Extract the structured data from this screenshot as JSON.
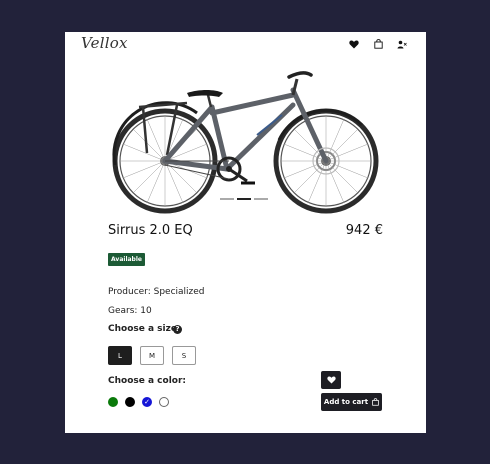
{
  "brand": {
    "logo_text": "Vellox"
  },
  "header": {
    "icons": [
      "heart-icon",
      "shopping-bag-icon",
      "user-icon"
    ]
  },
  "product": {
    "name": "Sirrus 2.0 EQ",
    "price": "942 €",
    "availability": "Available",
    "producer": "Producer: Specialized",
    "gears": "Gears: 10",
    "image_carousel": {
      "slides": 3,
      "active": 2
    }
  },
  "size": {
    "label": "Choose a size:",
    "options": [
      "L",
      "M",
      "S"
    ],
    "selected": "L"
  },
  "color": {
    "label": "Choose a color:",
    "options": [
      {
        "name": "green",
        "hex": "#0a7a0a"
      },
      {
        "name": "black",
        "hex": "#000000"
      },
      {
        "name": "blue",
        "hex": "#1515d6"
      },
      {
        "name": "white",
        "hex": "#ffffff"
      }
    ],
    "selected": "blue"
  },
  "actions": {
    "add_to_cart_label": "Add to cart",
    "wishlist_icon": "heart-icon"
  },
  "colors": {
    "background": "#22223a",
    "card": "#ffffff",
    "badge": "#1c5a35",
    "button_dark": "#1e1e24"
  }
}
